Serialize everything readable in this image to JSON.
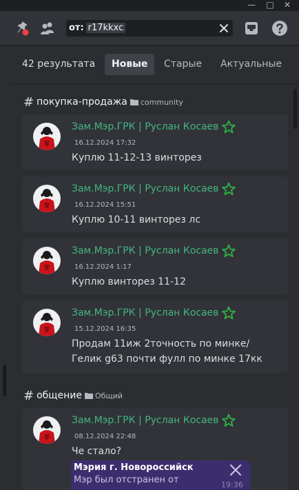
{
  "search": {
    "filter_label": "от:",
    "filter_value": "r17kkxc",
    "placeholder": ""
  },
  "results": {
    "count_label": "42 результата",
    "sort_tabs": [
      "Новые",
      "Старые",
      "Актуальные"
    ],
    "active_tab": "Новые"
  },
  "groups": [
    {
      "channel": "покупка-продажа",
      "category": "community",
      "messages": [
        {
          "author": "Зам.Мэр.ГРК | Руслан Косаев",
          "time": "16.12.2024 17:32",
          "text": "Куплю 11-12-13 винторез"
        },
        {
          "author": "Зам.Мэр.ГРК | Руслан Косаев",
          "time": "16.12.2024 15:51",
          "text": "Куплю 10-11 винторез лс"
        },
        {
          "author": "Зам.Мэр.ГРК | Руслан Косаев",
          "time": "16.12.2024 1:17",
          "text": "Куплю винторез 11-12"
        },
        {
          "author": "Зам.Мэр.ГРК | Руслан Косаев",
          "time": "15.12.2024 16:35",
          "text": "Продам 11иж 2точность по минке/ Гелик g63 почти фулл по минке 17кк"
        }
      ]
    },
    {
      "channel": "общение",
      "category": "Общий",
      "messages": [
        {
          "author": "Зам.Мэр.ГРК | Руслан Косаев",
          "time": "08.12.2024 22:48",
          "text": "Че стало?"
        }
      ]
    }
  ],
  "toast": {
    "title": "Мэрия г. Новороссийск",
    "body": "Мэр был отстранен от",
    "time": "19:36"
  },
  "colors": {
    "author": "#43b581",
    "star": "#2fb344",
    "background": "#2b2d31",
    "card": "#313338",
    "toast": "#3c2e6e"
  },
  "icons": [
    "pin-icon",
    "members-icon",
    "clear-icon",
    "inbox-icon",
    "help-icon",
    "folder-icon",
    "star-icon",
    "close-icon"
  ]
}
